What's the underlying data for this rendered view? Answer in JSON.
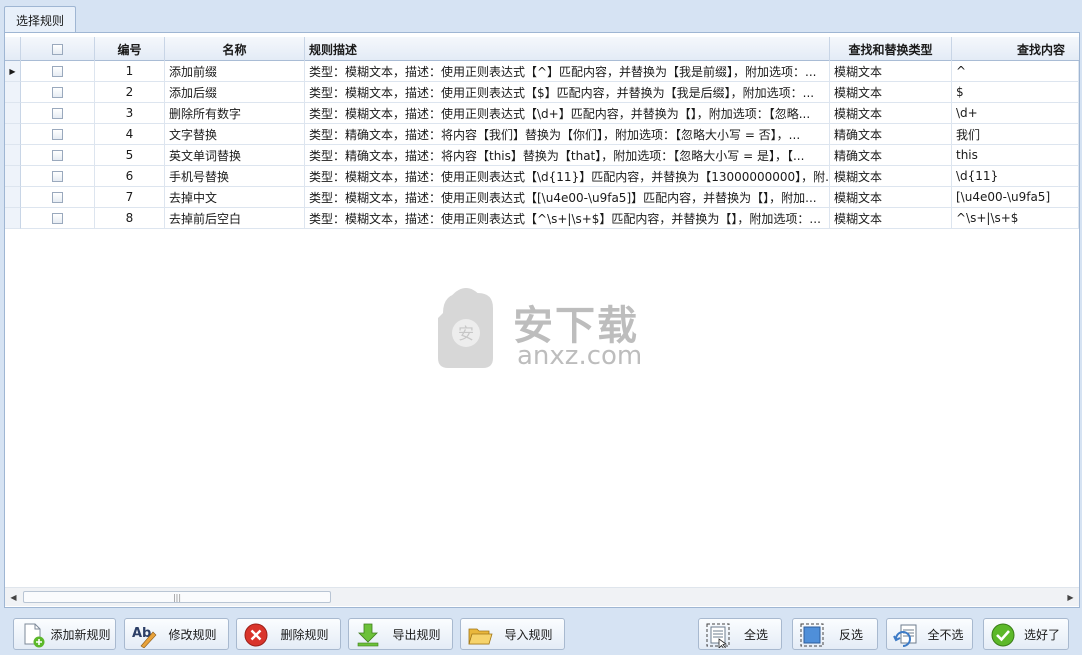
{
  "tab": {
    "label": "选择规则"
  },
  "columns": [
    {
      "key": "checkbox",
      "label": ""
    },
    {
      "key": "no",
      "label": "编号"
    },
    {
      "key": "name",
      "label": "名称"
    },
    {
      "key": "desc",
      "label": "规则描述"
    },
    {
      "key": "type",
      "label": "查找和替换类型"
    },
    {
      "key": "find",
      "label": "查找内容"
    }
  ],
  "rows": [
    {
      "no": "1",
      "name": "添加前缀",
      "desc": "类型：模糊文本，描述：使用正则表达式【^】匹配内容，并替换为【我是前缀】，附加选项：...",
      "type": "模糊文本",
      "find": "^"
    },
    {
      "no": "2",
      "name": "添加后缀",
      "desc": "类型：模糊文本，描述：使用正则表达式【$】匹配内容，并替换为【我是后缀】，附加选项：...",
      "type": "模糊文本",
      "find": "$"
    },
    {
      "no": "3",
      "name": "删除所有数字",
      "desc": "类型：模糊文本，描述：使用正则表达式【\\d+】匹配内容，并替换为【】，附加选项：【忽略...",
      "type": "模糊文本",
      "find": "\\d+"
    },
    {
      "no": "4",
      "name": "文字替换",
      "desc": "类型：精确文本，描述：将内容【我们】替换为【你们】，附加选项：【忽略大小写 = 否】，...",
      "type": "精确文本",
      "find": "我们"
    },
    {
      "no": "5",
      "name": "英文单词替换",
      "desc": "类型：精确文本，描述：将内容【this】替换为【that】，附加选项：【忽略大小写 = 是】，【...",
      "type": "精确文本",
      "find": "this"
    },
    {
      "no": "6",
      "name": "手机号替换",
      "desc": "类型：模糊文本，描述：使用正则表达式【\\d{11}】匹配内容，并替换为【13000000000】，附...",
      "type": "模糊文本",
      "find": "\\d{11}"
    },
    {
      "no": "7",
      "name": "去掉中文",
      "desc": "类型：模糊文本，描述：使用正则表达式【[\\u4e00-\\u9fa5]】匹配内容，并替换为【】，附加...",
      "type": "模糊文本",
      "find": "[\\u4e00-\\u9fa5]"
    },
    {
      "no": "8",
      "name": "去掉前后空白",
      "desc": "类型：模糊文本，描述：使用正则表达式【^\\s+|\\s+$】匹配内容，并替换为【】，附加选项：...",
      "type": "模糊文本",
      "find": "^\\s+|\\s+$"
    }
  ],
  "watermark": {
    "main": "安下载",
    "sub": "anxz.com"
  },
  "buttons": {
    "add": "添加新规则",
    "edit": "修改规则",
    "delete": "删除规则",
    "export": "导出规则",
    "import": "导入规则",
    "select_all": "全选",
    "invert": "反选",
    "select_none": "全不选",
    "ok": "选好了"
  },
  "colors": {
    "accent": "#3d7bc6",
    "header_bg": "#e3ebf6",
    "delete_red": "#d9342b",
    "ok_green": "#5cb82a"
  }
}
